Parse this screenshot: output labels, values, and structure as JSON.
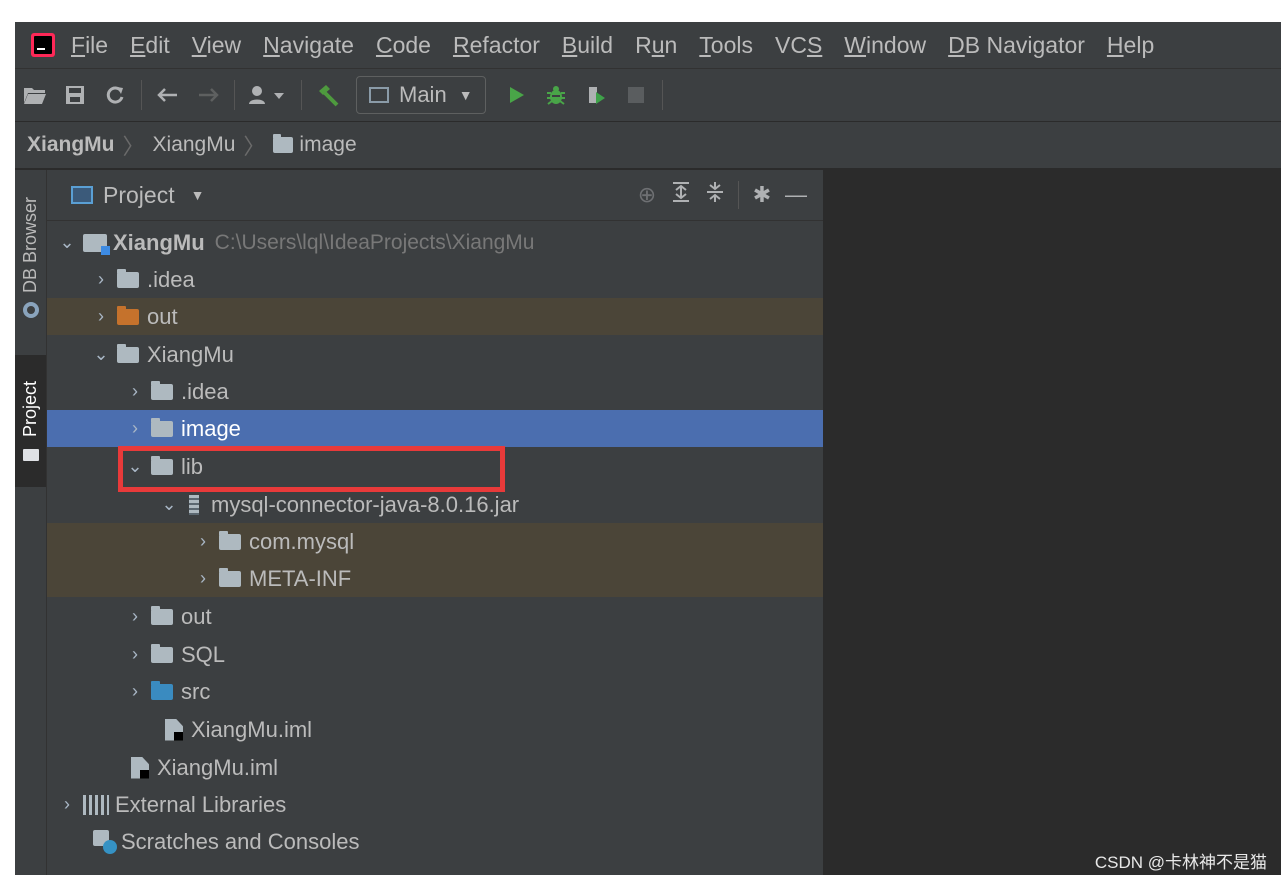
{
  "menu": {
    "items": [
      {
        "pre": "",
        "u": "F",
        "post": "ile"
      },
      {
        "pre": "",
        "u": "E",
        "post": "dit"
      },
      {
        "pre": "",
        "u": "V",
        "post": "iew"
      },
      {
        "pre": "",
        "u": "N",
        "post": "avigate"
      },
      {
        "pre": "",
        "u": "C",
        "post": "ode"
      },
      {
        "pre": "",
        "u": "R",
        "post": "efactor"
      },
      {
        "pre": "",
        "u": "B",
        "post": "uild"
      },
      {
        "pre": "R",
        "u": "u",
        "post": "n"
      },
      {
        "pre": "",
        "u": "T",
        "post": "ools"
      },
      {
        "pre": "VC",
        "u": "S",
        "post": ""
      },
      {
        "pre": "",
        "u": "W",
        "post": "indow"
      },
      {
        "pre": "",
        "u": "D",
        "post": "B Navigator"
      },
      {
        "pre": "",
        "u": "H",
        "post": "elp"
      }
    ]
  },
  "toolbar": {
    "run_config": "Main",
    "colors": {
      "run": "#49a548",
      "debug": "#49a548",
      "coverage": "#3fa24a",
      "stop": "#5a5d5f",
      "build": "#4e9a3e"
    }
  },
  "breadcrumb": {
    "project": "XiangMu",
    "module": "XiangMu",
    "folder": "image"
  },
  "stripe": {
    "db_browser": "DB Browser",
    "project": "Project"
  },
  "panel": {
    "title": "Project"
  },
  "tree": [
    {
      "label": "XiangMu",
      "path": "C:\\Users\\lql\\IdeaProjects\\XiangMu"
    },
    {
      "label": ".idea"
    },
    {
      "label": "out"
    },
    {
      "label": "XiangMu"
    },
    {
      "label": ".idea"
    },
    {
      "label": "image"
    },
    {
      "label": "lib"
    },
    {
      "label": "mysql-connector-java-8.0.16.jar"
    },
    {
      "label": "com.mysql"
    },
    {
      "label": "META-INF"
    },
    {
      "label": "out"
    },
    {
      "label": "SQL"
    },
    {
      "label": "src"
    },
    {
      "label": "XiangMu.iml"
    },
    {
      "label": "XiangMu.iml"
    },
    {
      "label": "External Libraries"
    },
    {
      "label": "Scratches and Consoles"
    }
  ],
  "watermark": "CSDN @卡林神不是猫"
}
